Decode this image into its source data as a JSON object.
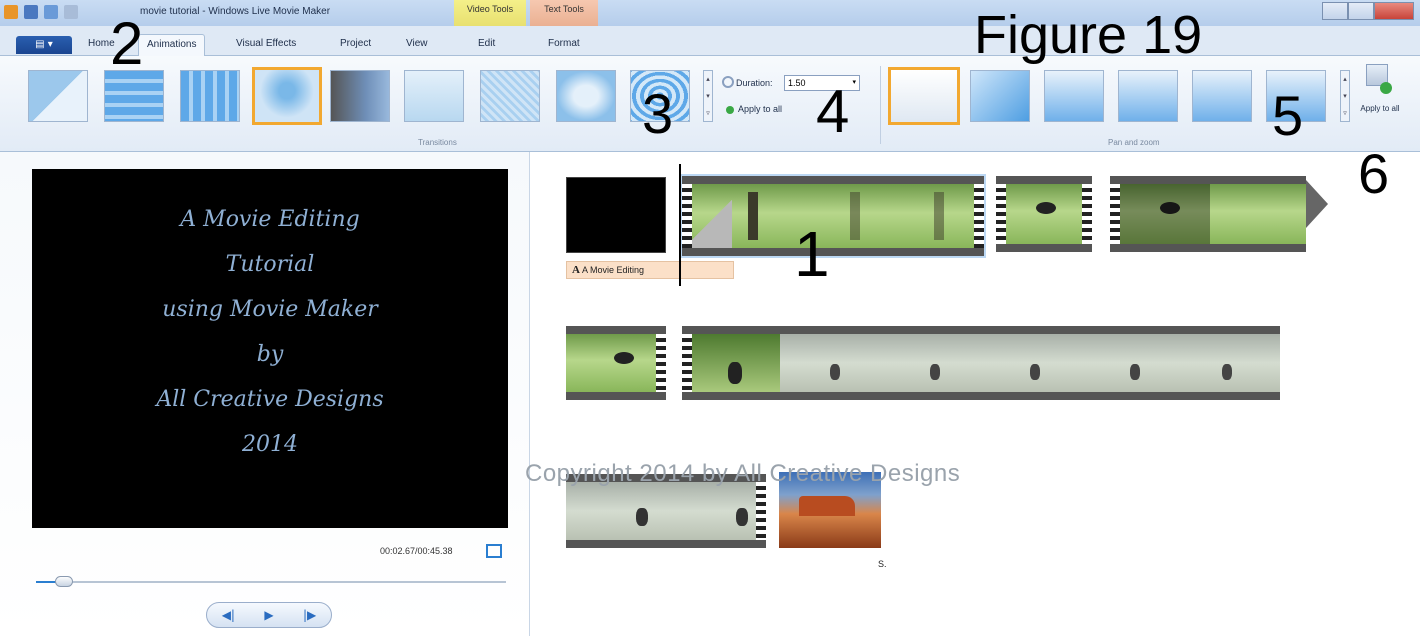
{
  "window": {
    "title": "movie tutorial - Windows Live Movie Maker",
    "context_tabs": [
      "Video Tools",
      "Text Tools"
    ]
  },
  "ribbon_tabs": {
    "home": "Home",
    "animations": "Animations",
    "visual_effects": "Visual Effects",
    "project": "Project",
    "view": "View",
    "edit": "Edit",
    "format": "Format"
  },
  "transitions": {
    "group_label": "Transitions",
    "duration_label": "Duration:",
    "duration_value": "1.50",
    "apply_to_all": "Apply to all"
  },
  "pan_zoom": {
    "group_label": "Pan and zoom",
    "apply_to_all": "Apply to all"
  },
  "annotations": {
    "figure": "Figure 19",
    "n1": "1",
    "n2": "2",
    "n3": "3",
    "n4": "4",
    "n5": "5",
    "n6": "6"
  },
  "preview": {
    "lines": [
      "A Movie Editing",
      "Tutorial",
      "using Movie Maker",
      "by",
      "All Creative Designs",
      "2014"
    ],
    "timecode": "00:02.67/00:45.38",
    "seek_fraction": 0.06
  },
  "storyboard": {
    "caption": "A Movie Editing",
    "caption_icon": "A",
    "small_label": "S."
  },
  "watermark": "Copyright 2014 by All Creative Designs",
  "colors": {
    "selection": "#f2a830",
    "accent": "#2a7ed0",
    "ribbon_bg": "#e2ebf6"
  }
}
